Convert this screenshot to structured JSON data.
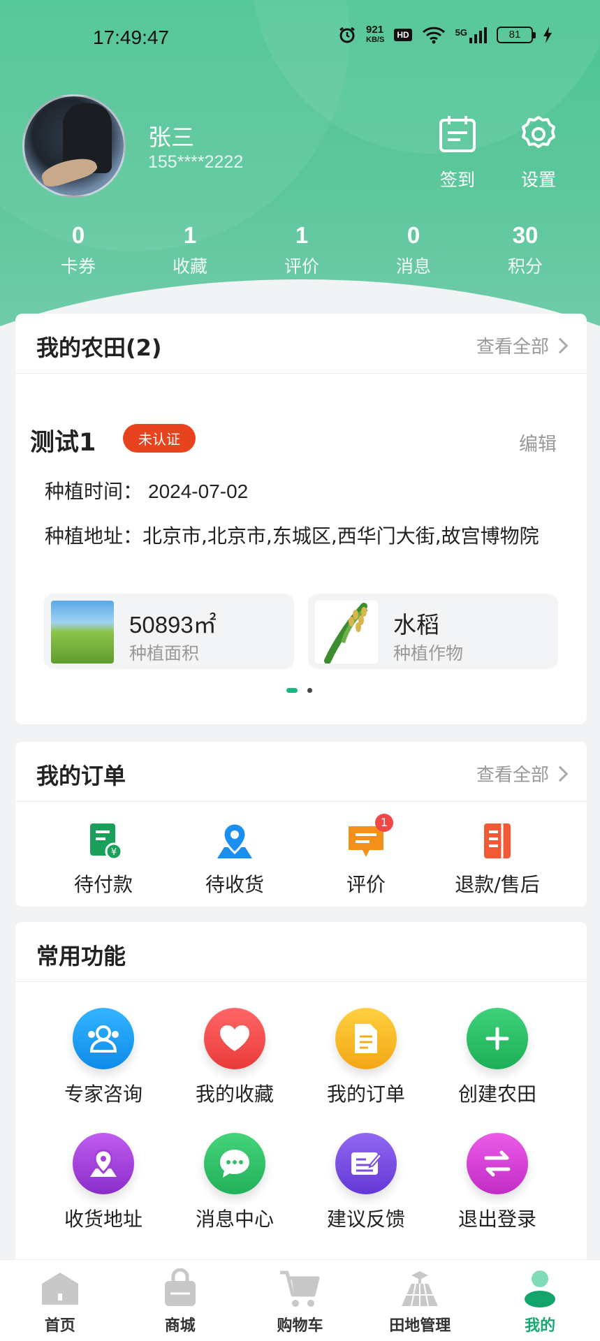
{
  "status_bar": {
    "time": "17:49:47",
    "net_speed_value": "921",
    "net_speed_unit": "KB/S",
    "hd": "HD",
    "signal": "5G",
    "battery": "81"
  },
  "profile": {
    "name": "张三",
    "phone": "155****2222",
    "checkin_label": "签到",
    "settings_label": "设置"
  },
  "stats": [
    {
      "value": "0",
      "label": "卡券"
    },
    {
      "value": "1",
      "label": "收藏"
    },
    {
      "value": "1",
      "label": "评价"
    },
    {
      "value": "0",
      "label": "消息"
    },
    {
      "value": "30",
      "label": "积分"
    }
  ],
  "farm": {
    "title": "我的农田(2)",
    "view_all": "查看全部",
    "name": "测试1",
    "badge": "未认证",
    "edit": "编辑",
    "time_label": "种植时间：",
    "time_value": "2024-07-02",
    "address_label": "种植地址：",
    "address_value": "北京市,北京市,东城区,西华门大街,故宫博物院",
    "area_value": "50893㎡",
    "area_label": "种植面积",
    "crop_value": "水稻",
    "crop_label": "种植作物",
    "carousel_pages": 2,
    "carousel_active": 1
  },
  "orders": {
    "title": "我的订单",
    "view_all": "查看全部",
    "items": [
      {
        "label": "待付款",
        "icon": "payment-pending-icon"
      },
      {
        "label": "待收货",
        "icon": "location-pin-icon"
      },
      {
        "label": "评价",
        "icon": "comment-icon",
        "badge": "1"
      },
      {
        "label": "退款/售后",
        "icon": "refund-icon"
      }
    ]
  },
  "functions": {
    "title": "常用功能",
    "items": [
      {
        "label": "专家咨询",
        "icon": "expert-icon",
        "color": "#1a9cf0"
      },
      {
        "label": "我的收藏",
        "icon": "heart-icon",
        "color": "#f04a4a"
      },
      {
        "label": "我的订单",
        "icon": "document-icon",
        "color": "#f4b51c"
      },
      {
        "label": "创建农田",
        "icon": "plus-icon",
        "color": "#27c064"
      },
      {
        "label": "收货地址",
        "icon": "map-pin-icon",
        "color": "#a43ed8"
      },
      {
        "label": "消息中心",
        "icon": "chat-icon",
        "color": "#2fbf64"
      },
      {
        "label": "建议反馈",
        "icon": "feedback-icon",
        "color": "#7a4de0"
      },
      {
        "label": "退出登录",
        "icon": "switch-icon",
        "color": "#d43ed0"
      }
    ]
  },
  "nav": [
    {
      "label": "首页",
      "icon": "home-icon"
    },
    {
      "label": "商城",
      "icon": "bag-icon"
    },
    {
      "label": "购物车",
      "icon": "cart-icon"
    },
    {
      "label": "田地管理",
      "icon": "field-icon"
    },
    {
      "label": "我的",
      "icon": "user-icon",
      "active": true
    }
  ],
  "colors": {
    "brand": "#18b784",
    "header": "#4cc493",
    "badge_red": "#e8431f"
  }
}
